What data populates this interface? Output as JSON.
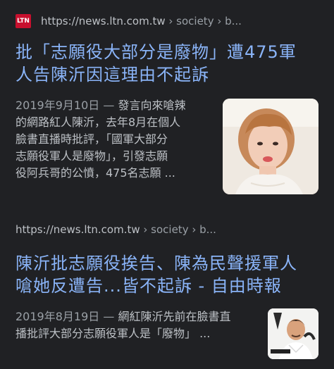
{
  "results": [
    {
      "favicon_text": "LTN",
      "url": "https://news.ltn.com.tw",
      "breadcrumb": " › society › b...",
      "title_line1": "批「志願役大部分是廢物」遭475軍",
      "title_line2": "人告陳沂因這理由不起訴",
      "date": "2019年9月10日 — ",
      "snippet_lines": [
        "發言向來嗆辣",
        "的網路紅人陳沂，去年8月在個人",
        "臉書直播時批評，「國軍大部分",
        "志願役軍人是廢物」，引發志願",
        "役阿兵哥的公憤，475名志願 ..."
      ]
    },
    {
      "url": "https://news.ltn.com.tw",
      "breadcrumb": " › society › b...",
      "title_line1": "陳沂批志願役挨告、陳為民聲援軍人",
      "title_line2": "嗆她反遭告...皆不起訴 - 自由時報",
      "date": "2019年8月19日 — ",
      "snippet_lines": [
        "網紅陳沂先前在臉書直",
        "播批評大部分志願役軍人是「廢物」 ..."
      ]
    }
  ]
}
